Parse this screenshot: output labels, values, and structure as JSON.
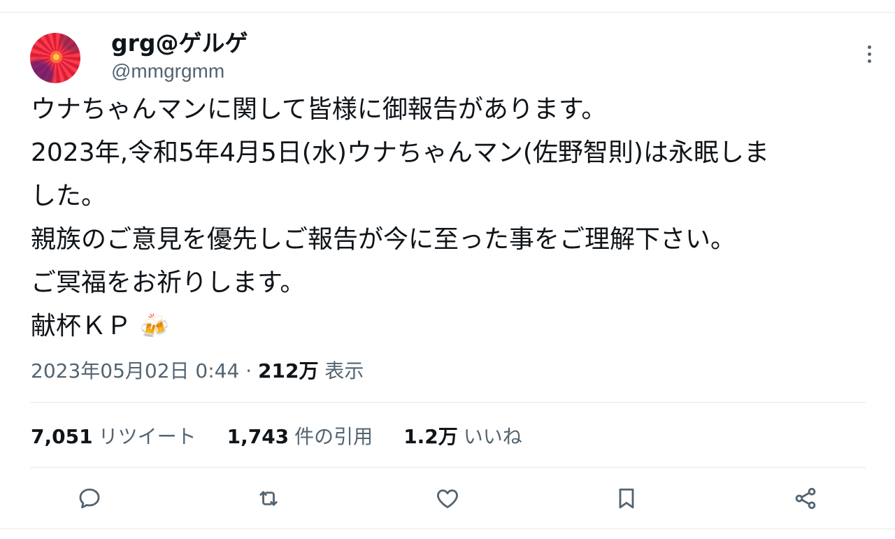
{
  "tweet": {
    "author": {
      "display_name": "grg@ゲルゲ",
      "handle": "@mmgrgmm"
    },
    "text_lines": [
      "ウナちゃんマンに関して皆様に御報告があります。",
      "2023年,令和5年4月5日(水)ウナちゃんマン(佐野智則)は永眠しま",
      "した。",
      "親族のご意見を優先しご報告が今に至った事をご理解下さい。",
      "ご冥福をお祈りします。",
      "献杯ＫＰ"
    ],
    "emoji": "🍻",
    "timestamp": "2023年05月02日 0:44",
    "separator": "·",
    "views_count": "212万",
    "views_label": "表示",
    "stats": {
      "retweets_count": "7,051",
      "retweets_label": "リツイート",
      "quotes_count": "1,743",
      "quotes_label": "件の引用",
      "likes_count": "1.2万",
      "likes_label": "いいね"
    }
  },
  "actions": {
    "reply": "reply-icon",
    "retweet": "retweet-icon",
    "like": "heart-icon",
    "bookmark": "bookmark-icon",
    "share": "share-icon"
  },
  "colors": {
    "text": "#0f1419",
    "secondary": "#536471",
    "divider": "#e7e9ea"
  }
}
